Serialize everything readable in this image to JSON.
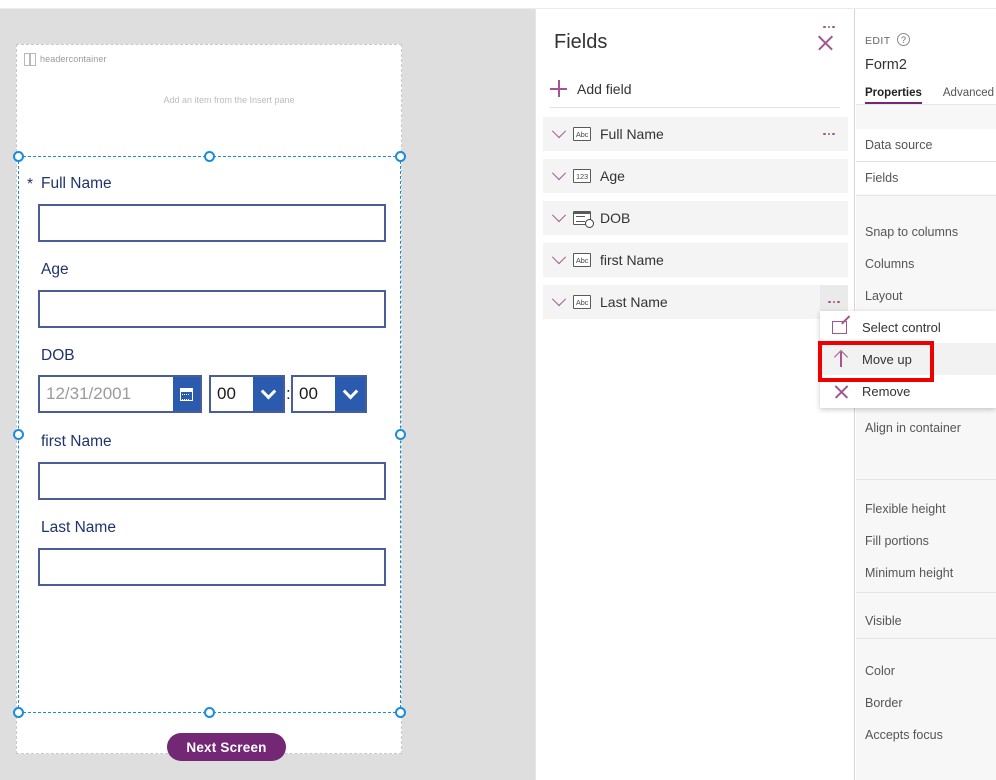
{
  "canvas": {
    "header_container": {
      "name": "headercontainer",
      "hint": "Add an item from the Insert pane"
    },
    "form_fields": [
      {
        "label": "Full Name",
        "required": true,
        "type": "text"
      },
      {
        "label": "Age",
        "required": false,
        "type": "text"
      },
      {
        "label": "DOB",
        "required": false,
        "type": "datetime",
        "date_value": "12/31/2001",
        "hour_value": "00",
        "minute_value": "00",
        "separator": ":"
      },
      {
        "label": "first Name",
        "required": false,
        "type": "text"
      },
      {
        "label": "Last Name",
        "required": false,
        "type": "text"
      }
    ],
    "required_marker": "*",
    "next_button_label": "Next Screen",
    "accent_purple": "#742774",
    "input_border_color": "#4a5c9a",
    "selection_color": "#1a8cde",
    "datetime_button_color": "#2b5bae"
  },
  "fields_panel": {
    "title": "Fields",
    "close_icon": "close-icon",
    "add_field_label": "Add field",
    "add_field_icon": "plus-icon",
    "more_icon": "ellipsis-icon",
    "items": [
      {
        "label": "Full Name",
        "type_icon": "Abc",
        "type": "text",
        "more_active": false
      },
      {
        "label": "Age",
        "type_icon": "123",
        "type": "number",
        "more_active": false
      },
      {
        "label": "DOB",
        "type_icon": "",
        "type": "datetime",
        "more_active": false
      },
      {
        "label": "first Name",
        "type_icon": "Abc",
        "type": "text",
        "more_active": false
      },
      {
        "label": "Last Name",
        "type_icon": "Abc",
        "type": "text",
        "more_active": true
      }
    ]
  },
  "context_menu": {
    "items": [
      {
        "label": "Select control",
        "icon": "select-control-icon",
        "highlighted": false
      },
      {
        "label": "Move up",
        "icon": "arrow-up-icon",
        "highlighted": true
      },
      {
        "label": "Remove",
        "icon": "remove-x-icon",
        "highlighted": false
      }
    ],
    "highlight_color": "#ef0000"
  },
  "properties_panel": {
    "edit_label": "EDIT",
    "help_icon": "?",
    "control_name": "Form2",
    "tabs": [
      {
        "label": "Properties",
        "active": true
      },
      {
        "label": "Advanced",
        "active": false
      }
    ],
    "groups": [
      {
        "items": [
          {
            "label": "Data source",
            "white": true
          },
          {
            "label": "Fields",
            "white": true
          }
        ]
      },
      {
        "items": [
          {
            "label": "Snap to columns",
            "white": false
          },
          {
            "label": "Columns",
            "white": false
          },
          {
            "label": "Layout",
            "white": false
          },
          {
            "label": "Align in container",
            "white": false
          }
        ]
      },
      {
        "items": [
          {
            "label": "Flexible height",
            "white": false
          },
          {
            "label": "Fill portions",
            "white": false
          },
          {
            "label": "Minimum height",
            "white": false
          }
        ]
      },
      {
        "items": [
          {
            "label": "Visible",
            "white": false
          }
        ]
      },
      {
        "items": [
          {
            "label": "Color",
            "white": false
          },
          {
            "label": "Border",
            "white": false
          },
          {
            "label": "Accepts focus",
            "white": false
          }
        ]
      }
    ]
  }
}
